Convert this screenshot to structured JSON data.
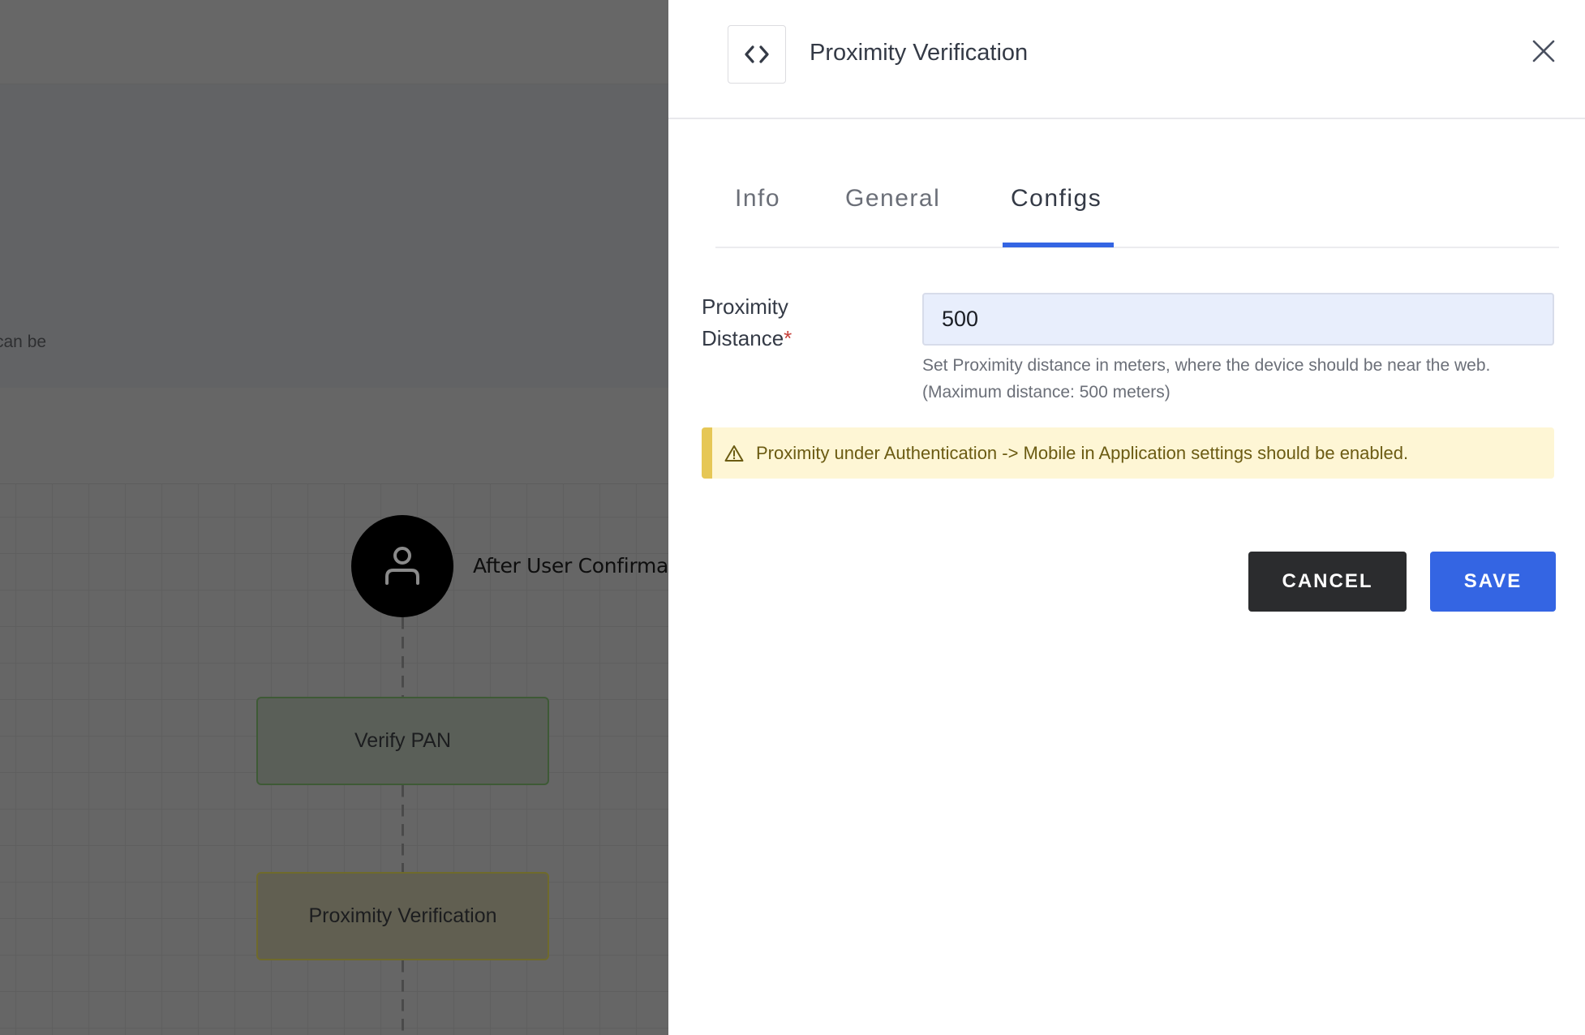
{
  "background": {
    "card_text_fragment": "can be",
    "flow": {
      "start_node_label": "After User Confirmat",
      "start_node_icon": "user-icon",
      "steps": [
        {
          "label": "Verify PAN",
          "color": "#3e5a36"
        },
        {
          "label": "Proximity Verification",
          "color": "#6f6a2b"
        }
      ]
    }
  },
  "drawer": {
    "header_icon": "code-icon",
    "title": "Proximity Verification",
    "close_icon": "close-icon",
    "tabs": [
      {
        "label": "Info",
        "active": false
      },
      {
        "label": "General",
        "active": false
      },
      {
        "label": "Configs",
        "active": true
      }
    ],
    "form": {
      "field_label": "Proximity",
      "field_label_line2": "Distance",
      "required_mark": "*",
      "value": "500",
      "help_line1": "Set Proximity distance in meters, where the device should be near the web.",
      "help_line2": "(Maximum distance: 500 meters)"
    },
    "alert": {
      "icon": "warning-icon",
      "text": "Proximity under Authentication -> Mobile in Application settings should be enabled."
    },
    "buttons": {
      "cancel": "CANCEL",
      "save": "SAVE"
    }
  },
  "colors": {
    "accent": "#3465e3",
    "cancel_bg": "#2b2c2e",
    "alert_bg": "#fef6d5",
    "alert_border": "#e6c756",
    "input_bg": "#e8eefc"
  }
}
